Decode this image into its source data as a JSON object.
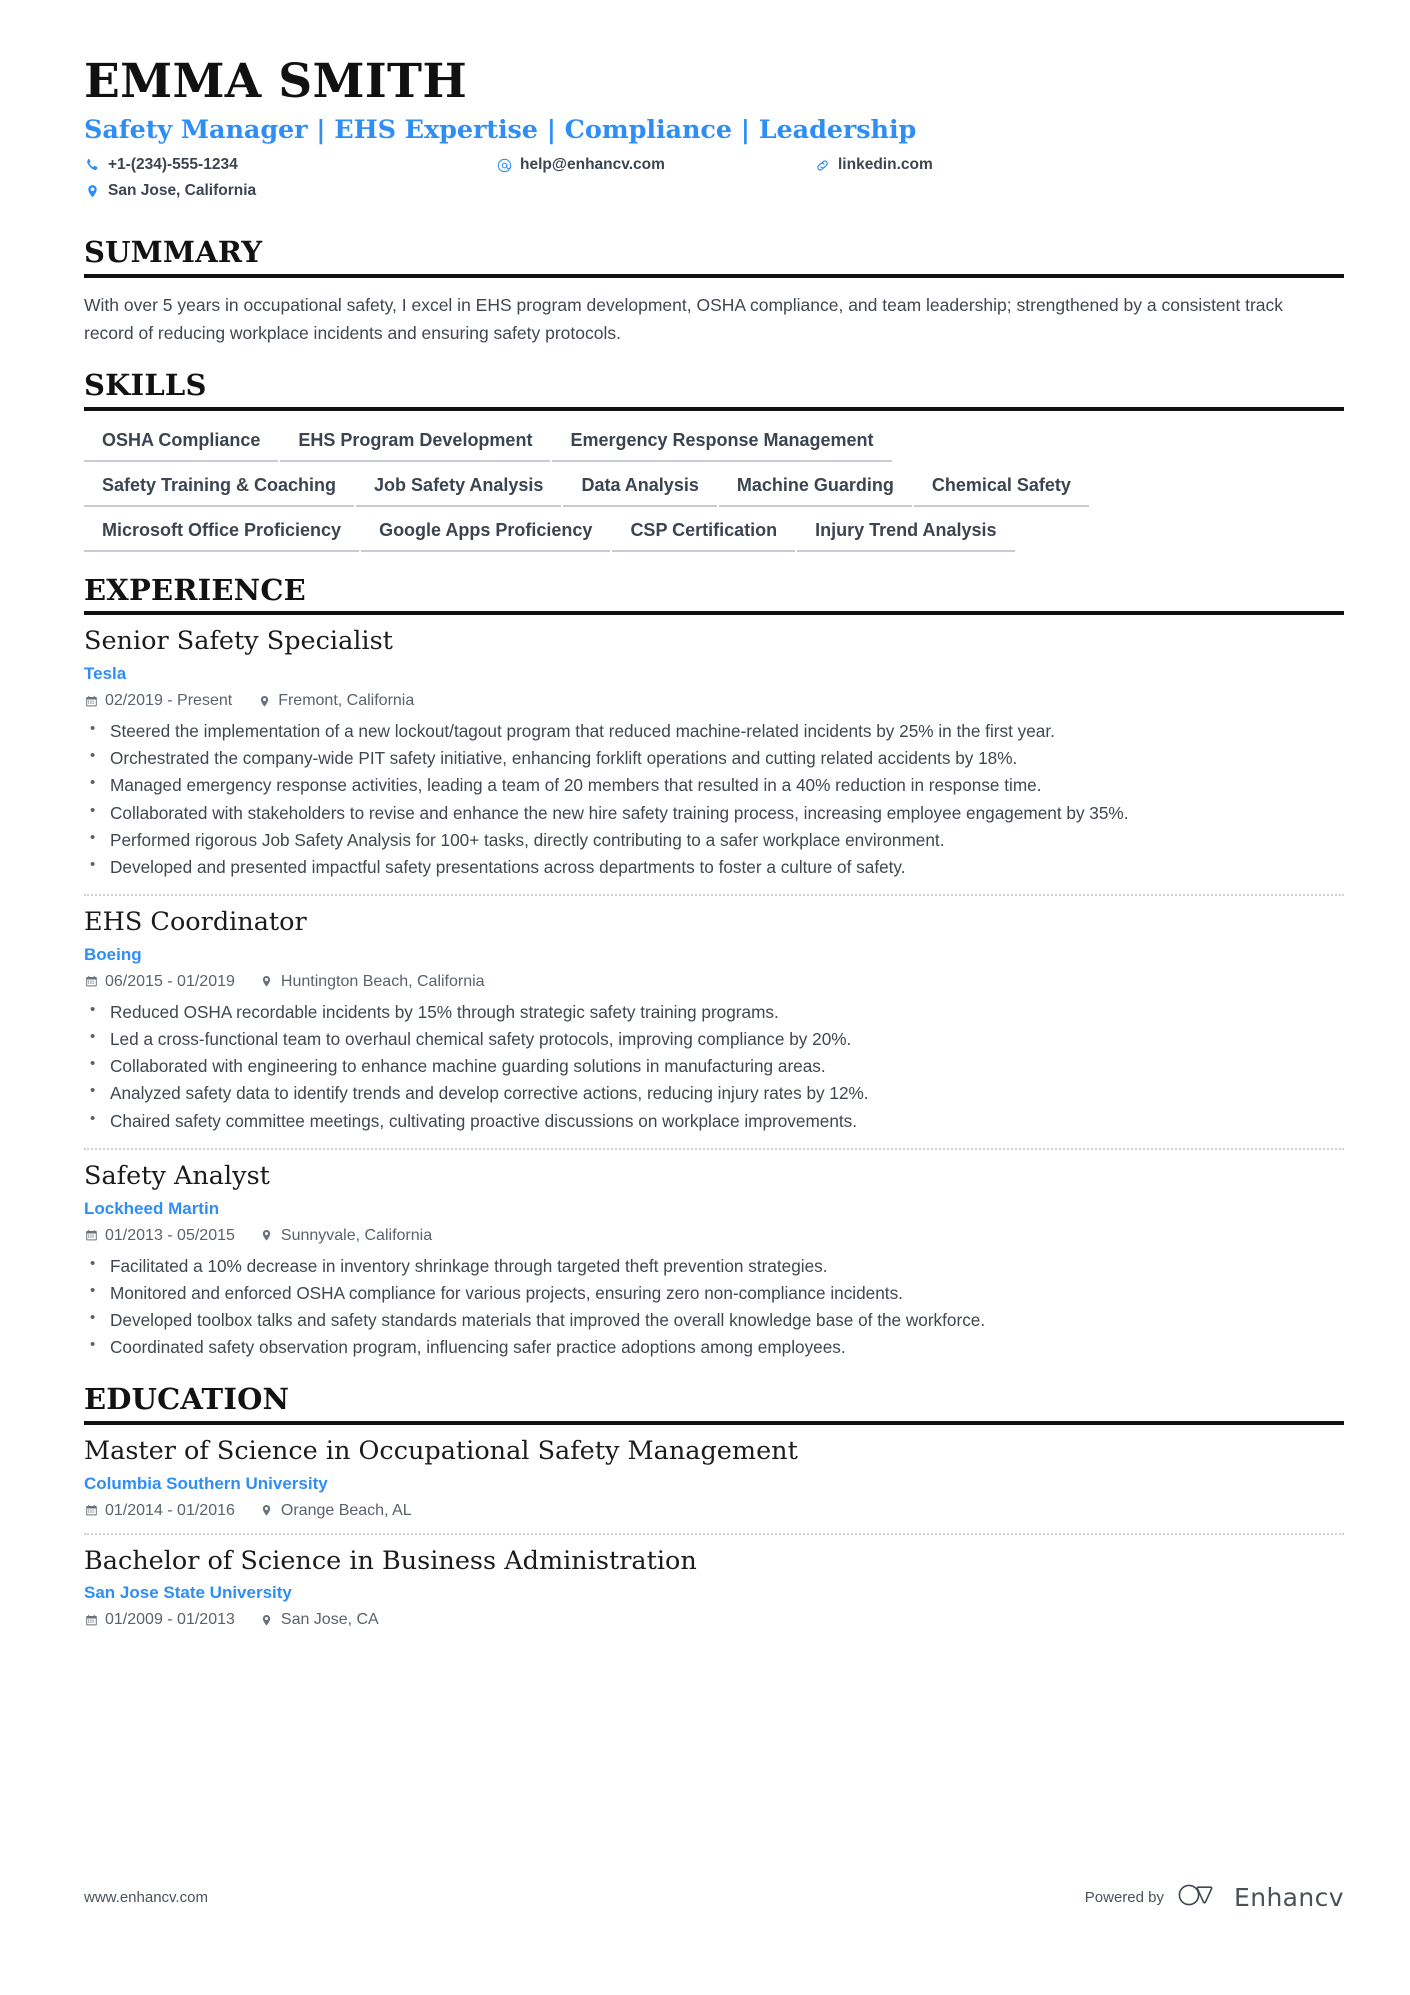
{
  "header": {
    "name": "EMMA SMITH",
    "headline": "Safety Manager | EHS Expertise | Compliance | Leadership",
    "contacts": [
      {
        "icon": "phone-icon",
        "value": "+1-(234)-555-1234"
      },
      {
        "icon": "email-icon",
        "value": "help@enhancv.com"
      },
      {
        "icon": "link-icon",
        "value": "linkedin.com"
      },
      {
        "icon": "location-pin-icon",
        "value": "San Jose, California"
      }
    ]
  },
  "summary": {
    "heading": "SUMMARY",
    "text": "With over 5 years in occupational safety, I excel in EHS program development, OSHA compliance, and team leadership; strengthened by a consistent track record of reducing workplace incidents and ensuring safety protocols."
  },
  "skills": {
    "heading": "SKILLS",
    "rows": [
      [
        "OSHA Compliance",
        "EHS Program Development",
        "Emergency Response Management"
      ],
      [
        "Safety Training & Coaching",
        "Job Safety Analysis",
        "Data Analysis",
        "Machine Guarding",
        "Chemical Safety"
      ],
      [
        "Microsoft Office Proficiency",
        "Google Apps Proficiency",
        "CSP Certification",
        "Injury Trend Analysis"
      ]
    ]
  },
  "experience": {
    "heading": "EXPERIENCE",
    "entries": [
      {
        "title": "Senior Safety Specialist",
        "org": "Tesla",
        "dates": "02/2019 - Present",
        "location": "Fremont, California",
        "bullets": [
          "Steered the implementation of a new lockout/tagout program that reduced machine-related incidents by 25% in the first year.",
          "Orchestrated the company-wide PIT safety initiative, enhancing forklift operations and cutting related accidents by 18%.",
          "Managed emergency response activities, leading a team of 20 members that resulted in a 40% reduction in response time.",
          "Collaborated with stakeholders to revise and enhance the new hire safety training process, increasing employee engagement by 35%.",
          "Performed rigorous Job Safety Analysis for 100+ tasks, directly contributing to a safer workplace environment.",
          "Developed and presented impactful safety presentations across departments to foster a culture of safety."
        ]
      },
      {
        "title": "EHS Coordinator",
        "org": "Boeing",
        "dates": "06/2015 - 01/2019",
        "location": "Huntington Beach, California",
        "bullets": [
          "Reduced OSHA recordable incidents by 15% through strategic safety training programs.",
          "Led a cross-functional team to overhaul chemical safety protocols, improving compliance by 20%.",
          "Collaborated with engineering to enhance machine guarding solutions in manufacturing areas.",
          "Analyzed safety data to identify trends and develop corrective actions, reducing injury rates by 12%.",
          "Chaired safety committee meetings, cultivating proactive discussions on workplace improvements."
        ]
      },
      {
        "title": "Safety Analyst",
        "org": "Lockheed Martin",
        "dates": "01/2013 - 05/2015",
        "location": "Sunnyvale, California",
        "bullets": [
          "Facilitated a 10% decrease in inventory shrinkage through targeted theft prevention strategies.",
          "Monitored and enforced OSHA compliance for various projects, ensuring zero non-compliance incidents.",
          "Developed toolbox talks and safety standards materials that improved the overall knowledge base of the workforce.",
          "Coordinated safety observation program, influencing safer practice adoptions among employees."
        ]
      }
    ]
  },
  "education": {
    "heading": "EDUCATION",
    "entries": [
      {
        "title": "Master of Science in Occupational Safety Management",
        "org": "Columbia Southern University",
        "dates": "01/2014 - 01/2016",
        "location": "Orange Beach, AL"
      },
      {
        "title": "Bachelor of Science in Business Administration",
        "org": "San Jose State University",
        "dates": "01/2009 - 01/2013",
        "location": "San Jose, CA"
      }
    ]
  },
  "footer": {
    "url": "www.enhancv.com",
    "powered_by": "Powered by",
    "brand": "Enhancv"
  },
  "colors": {
    "accent": "#2f8ef5",
    "rule": "#111111",
    "body_text": "#41474f",
    "chip_underline": "#c8ccd2"
  }
}
